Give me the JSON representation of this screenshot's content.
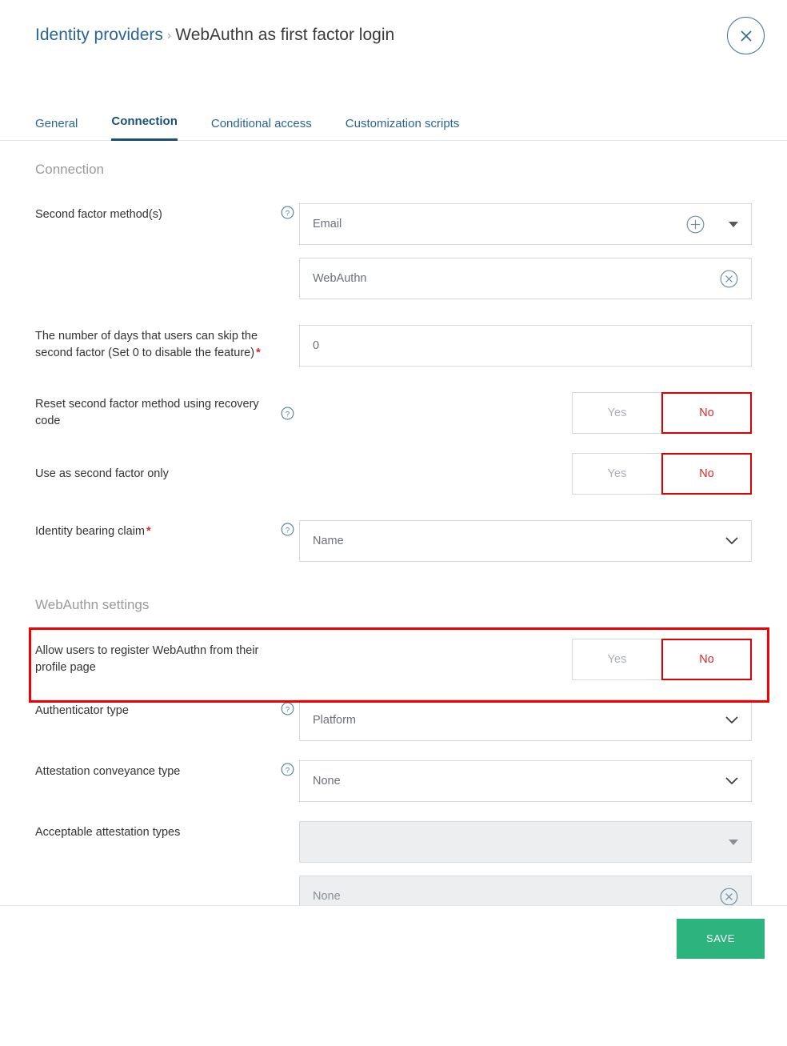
{
  "header": {
    "breadcrumb_parent": "Identity providers",
    "breadcrumb_separator": "›",
    "breadcrumb_current": "WebAuthn as first factor login",
    "close_label": "close-icon"
  },
  "tabs": [
    {
      "label": "General",
      "active": false
    },
    {
      "label": "Connection",
      "active": true
    },
    {
      "label": "Conditional access",
      "active": false
    },
    {
      "label": "Customization scripts",
      "active": false
    }
  ],
  "sections": {
    "connection": {
      "title": "Connection",
      "second_factor": {
        "label": "Second factor method(s)",
        "value": "Email",
        "tag_value": "WebAuthn"
      },
      "skip_days": {
        "label": "The number of days that users can skip the second factor (Set 0 to disable the feature)",
        "required": "*",
        "value": "0"
      },
      "reset_recovery": {
        "label": "Reset second factor method using recovery code",
        "yes": "Yes",
        "no": "No",
        "selected": "No"
      },
      "second_factor_only": {
        "label": "Use as second factor only",
        "yes": "Yes",
        "no": "No",
        "selected": "No"
      },
      "identity_claim": {
        "label": "Identity bearing claim",
        "required": "*",
        "value": "Name"
      }
    },
    "webauthn": {
      "title": "WebAuthn settings",
      "allow_register": {
        "label": "Allow users to register WebAuthn from their profile page",
        "yes": "Yes",
        "no": "No",
        "selected": "No"
      },
      "authenticator_type": {
        "label": "Authenticator type",
        "value": "Platform"
      },
      "attestation_conveyance": {
        "label": "Attestation conveyance type",
        "value": "None"
      },
      "acceptable_attestation": {
        "label": "Acceptable attestation types",
        "value": "",
        "tag_value": "None"
      }
    }
  },
  "footer": {
    "save_label": "SAVE"
  },
  "colors": {
    "accent_blue": "#2a6496",
    "active_tab": "#1d5078",
    "danger_red": "#d7282f",
    "highlight_red": "#f40000",
    "save_green": "#2cb37e",
    "label_gray": "#9a9a9a"
  }
}
